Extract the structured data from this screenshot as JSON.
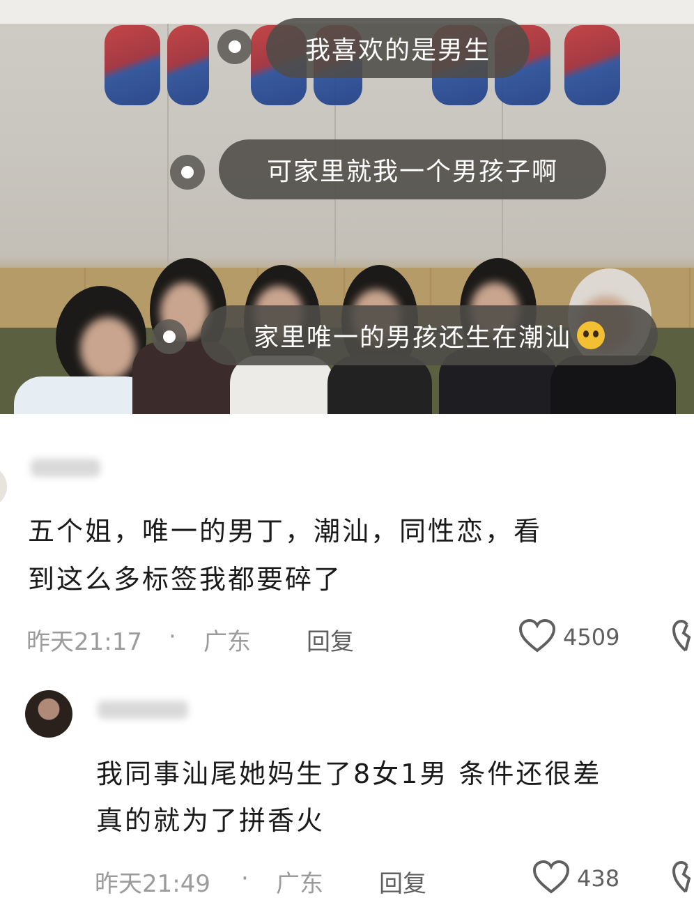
{
  "video": {
    "subtitles": [
      "我喜欢的是男生",
      "可家里就我一个男孩子啊",
      "家里唯一的男孩还生在潮汕"
    ],
    "subtitle_emoji": "crying-face-emoji"
  },
  "comments": [
    {
      "text_line1": "五个姐，唯一的男丁，潮汕，同性恋，看",
      "text_line2": "到这么多标签我都要碎了",
      "time": "昨天21:17",
      "separator": "·",
      "location": "广东",
      "reply_label": "回复",
      "likes": "4509"
    },
    {
      "text_line1": "我同事汕尾她妈生了8女1男 条件还很差",
      "text_line2": "真的就为了拼香火",
      "time": "昨天21:49",
      "separator": "·",
      "location": "广东",
      "reply_label": "回复",
      "likes": "438"
    }
  ]
}
